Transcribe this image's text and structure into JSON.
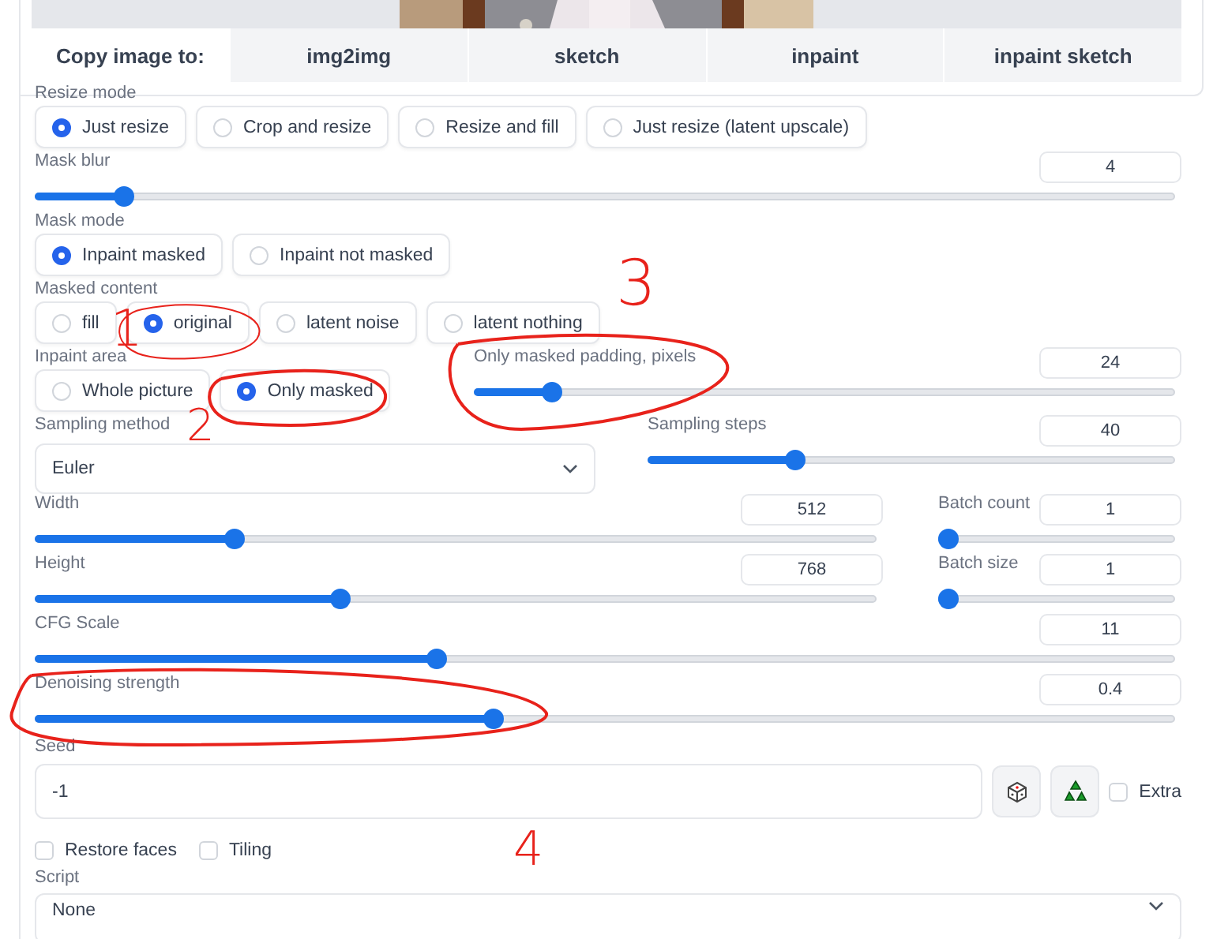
{
  "copy_image": {
    "label": "Copy image to:",
    "targets": [
      "img2img",
      "sketch",
      "inpaint",
      "inpaint sketch"
    ]
  },
  "resize_mode": {
    "label": "Resize mode",
    "options": [
      {
        "label": "Just resize",
        "selected": true
      },
      {
        "label": "Crop and resize",
        "selected": false
      },
      {
        "label": "Resize and fill",
        "selected": false
      },
      {
        "label": "Just resize (latent upscale)",
        "selected": false
      }
    ]
  },
  "mask_blur": {
    "label": "Mask blur",
    "value": "4",
    "level": 0.07
  },
  "mask_mode": {
    "label": "Mask mode",
    "options": [
      {
        "label": "Inpaint masked",
        "selected": true
      },
      {
        "label": "Inpaint not masked",
        "selected": false
      }
    ]
  },
  "masked_content": {
    "label": "Masked content",
    "options": [
      {
        "label": "fill",
        "selected": false
      },
      {
        "label": "original",
        "selected": true
      },
      {
        "label": "latent noise",
        "selected": false
      },
      {
        "label": "latent nothing",
        "selected": false
      }
    ]
  },
  "inpaint_area": {
    "label": "Inpaint area",
    "options": [
      {
        "label": "Whole picture",
        "selected": false
      },
      {
        "label": "Only masked",
        "selected": true
      }
    ]
  },
  "padding": {
    "label": "Only masked padding, pixels",
    "value": "24",
    "level": 0.1
  },
  "sampling_method": {
    "label": "Sampling method",
    "value": "Euler"
  },
  "sampling_steps": {
    "label": "Sampling steps",
    "value": "40",
    "level": 0.27
  },
  "width": {
    "label": "Width",
    "value": "512",
    "level": 0.23
  },
  "batch_count": {
    "label": "Batch count",
    "value": "1",
    "level": 0
  },
  "height": {
    "label": "Height",
    "value": "768",
    "level": 0.36
  },
  "batch_size": {
    "label": "Batch size",
    "value": "1",
    "level": 0
  },
  "cfg_scale": {
    "label": "CFG Scale",
    "value": "11",
    "level": 0.35
  },
  "denoising_strength": {
    "label": "Denoising strength",
    "value": "0.4",
    "level": 0.4
  },
  "seed": {
    "label": "Seed",
    "value": "-1"
  },
  "extra": {
    "label": "Extra",
    "checked": false
  },
  "options": [
    {
      "label": "Restore faces",
      "checked": false
    },
    {
      "label": "Tiling",
      "checked": false
    }
  ],
  "script": {
    "label": "Script",
    "value": "None"
  },
  "annotations": [
    {
      "text": "1"
    },
    {
      "text": "2"
    },
    {
      "text": "3"
    },
    {
      "text": "4"
    }
  ]
}
